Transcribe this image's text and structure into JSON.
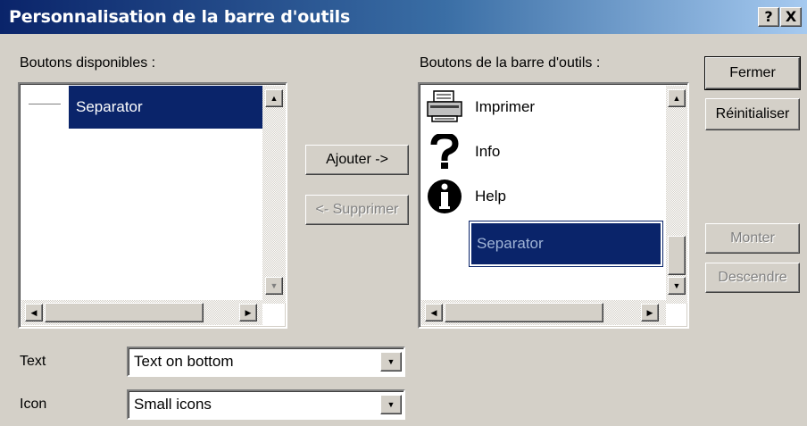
{
  "window": {
    "title": "Personnalisation de la barre d'outils",
    "help_glyph": "?",
    "close_glyph": "X"
  },
  "available": {
    "label": "Boutons disponibles :",
    "items": [
      {
        "label": "Separator",
        "icon": "separator-line-icon",
        "selected": true
      }
    ]
  },
  "toolbar": {
    "label": "Boutons de la barre d'outils :",
    "items": [
      {
        "label": "Imprimer",
        "icon": "printer-icon"
      },
      {
        "label": "Info",
        "icon": "question-mark-icon"
      },
      {
        "label": "Help",
        "icon": "info-icon"
      },
      {
        "label": "Separator",
        "icon": "separator-line-icon",
        "selected": true
      }
    ]
  },
  "buttons": {
    "add": "Ajouter ->",
    "remove": "<- Supprimer",
    "close": "Fermer",
    "reset": "Réinitialiser",
    "up": "Monter",
    "down": "Descendre"
  },
  "options": {
    "text_label": "Text",
    "text_value": "Text on bottom",
    "icon_label": "Icon",
    "icon_value": "Small icons"
  },
  "colors": {
    "selection": "#0a246a",
    "face": "#d4d0c8"
  }
}
